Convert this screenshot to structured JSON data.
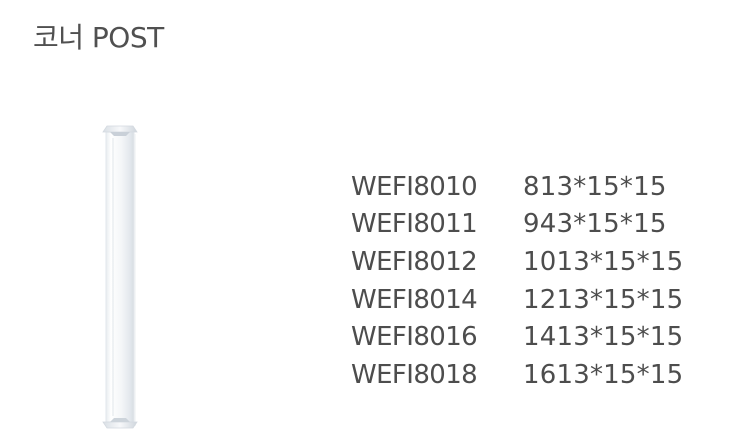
{
  "title": "코너 POST",
  "product_image": {
    "icon": "corner-post-icon",
    "color": "#f1f4f7"
  },
  "specs": [
    {
      "model": "WEFI8010",
      "size": "813*15*15"
    },
    {
      "model": "WEFI8011",
      "size": "943*15*15"
    },
    {
      "model": "WEFI8012",
      "size": "1013*15*15"
    },
    {
      "model": "WEFI8014",
      "size": "1213*15*15"
    },
    {
      "model": "WEFI8016",
      "size": "1413*15*15"
    },
    {
      "model": "WEFI8018",
      "size": "1613*15*15"
    }
  ]
}
